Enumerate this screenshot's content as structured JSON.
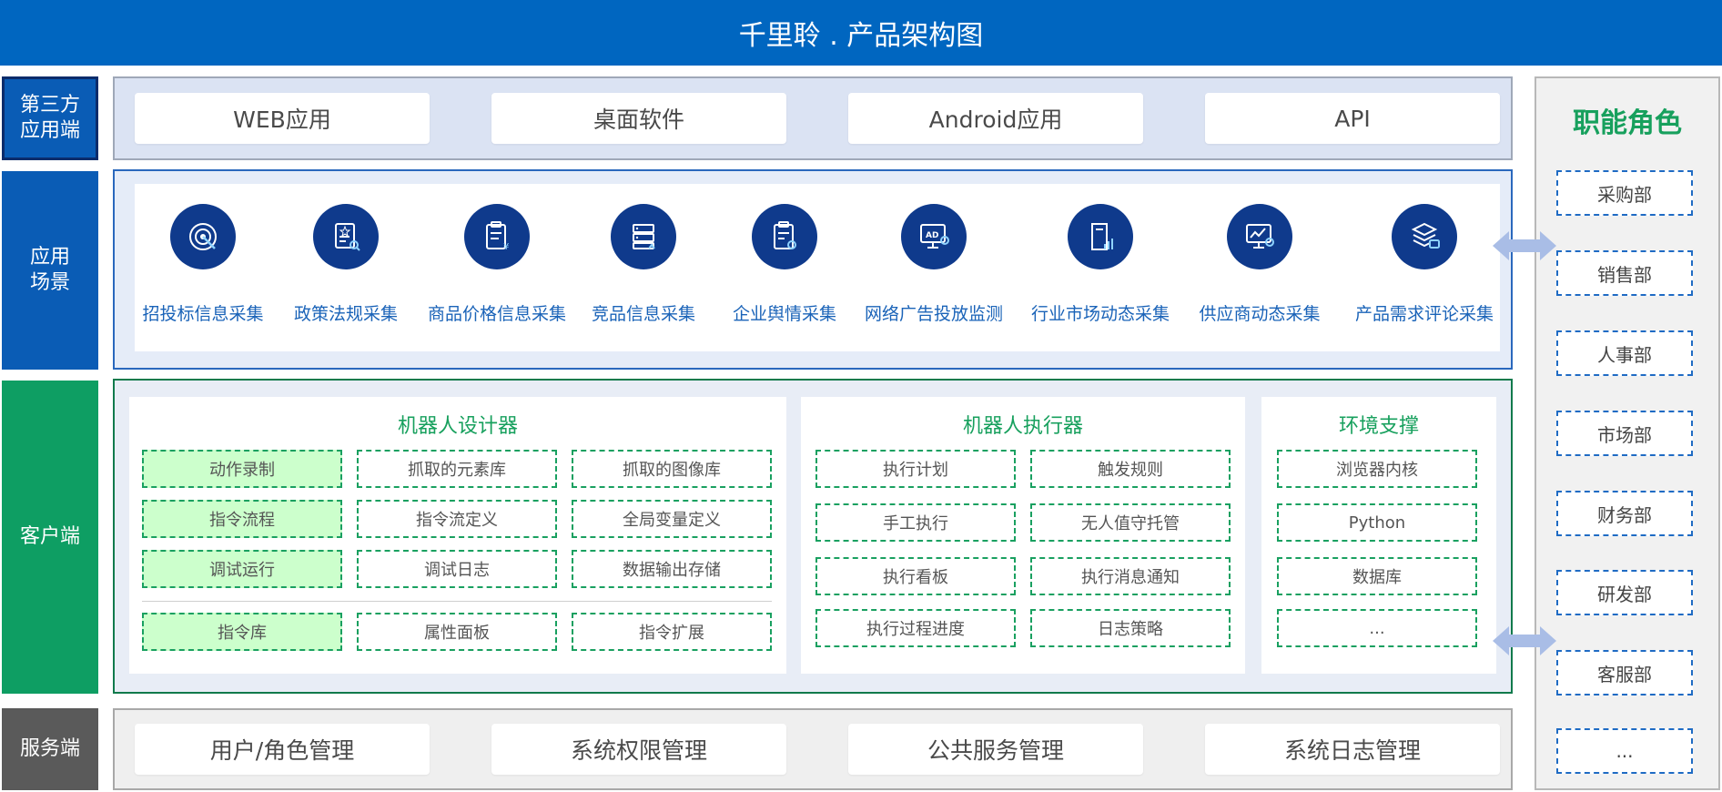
{
  "title": "千里聆 . 产品架构图",
  "layers": {
    "third_party": {
      "label_lines": [
        "第三方",
        "应用端"
      ],
      "items": [
        "WEB应用",
        "桌面软件",
        "Android应用",
        "API"
      ]
    },
    "scenarios": {
      "label_lines": [
        "应用",
        "场景"
      ],
      "items": [
        {
          "label": "招投标信息采集",
          "icon": "target-icon"
        },
        {
          "label": "政策法规采集",
          "icon": "document-search-icon"
        },
        {
          "label": "商品价格信息采集",
          "icon": "price-list-icon"
        },
        {
          "label": "竞品信息采集",
          "icon": "server-icon"
        },
        {
          "label": "企业舆情采集",
          "icon": "clipboard-icon"
        },
        {
          "label": "网络广告投放监测",
          "icon": "ad-monitor-icon"
        },
        {
          "label": "行业市场动态采集",
          "icon": "market-chart-icon"
        },
        {
          "label": "供应商动态采集",
          "icon": "screen-chart-icon"
        },
        {
          "label": "产品需求评论采集",
          "icon": "layers-comment-icon"
        }
      ]
    },
    "client": {
      "label": "客户端",
      "designer": {
        "title": "机器人设计器",
        "rows": [
          [
            "动作录制",
            "抓取的元素库",
            "抓取的图像库"
          ],
          [
            "指令流程",
            "指令流定义",
            "全局变量定义"
          ],
          [
            "调试运行",
            "调试日志",
            "数据输出存储"
          ]
        ],
        "extra_row": [
          "指令库",
          "属性面板",
          "指令扩展"
        ]
      },
      "executor": {
        "title": "机器人执行器",
        "rows": [
          [
            "执行计划",
            "触发规则"
          ],
          [
            "手工执行",
            "无人值守托管"
          ],
          [
            "执行看板",
            "执行消息通知"
          ],
          [
            "执行过程进度",
            "日志策略"
          ]
        ]
      },
      "environment": {
        "title": "环境支撑",
        "items": [
          "浏览器内核",
          "Python",
          "数据库",
          "..."
        ]
      }
    },
    "server": {
      "label": "服务端",
      "items": [
        "用户/角色管理",
        "系统权限管理",
        "公共服务管理",
        "系统日志管理"
      ]
    }
  },
  "roles": {
    "title": "职能角色",
    "items": [
      "采购部",
      "销售部",
      "人事部",
      "市场部",
      "财务部",
      "研发部",
      "客服部",
      "..."
    ]
  },
  "colors": {
    "banner": "#0066c0",
    "blue_layer": "#0a5cb5",
    "green_layer": "#0e9e63",
    "server_layer": "#5a5a5a",
    "accent_green": "#17a05d",
    "arrow": "#a9bde6"
  }
}
